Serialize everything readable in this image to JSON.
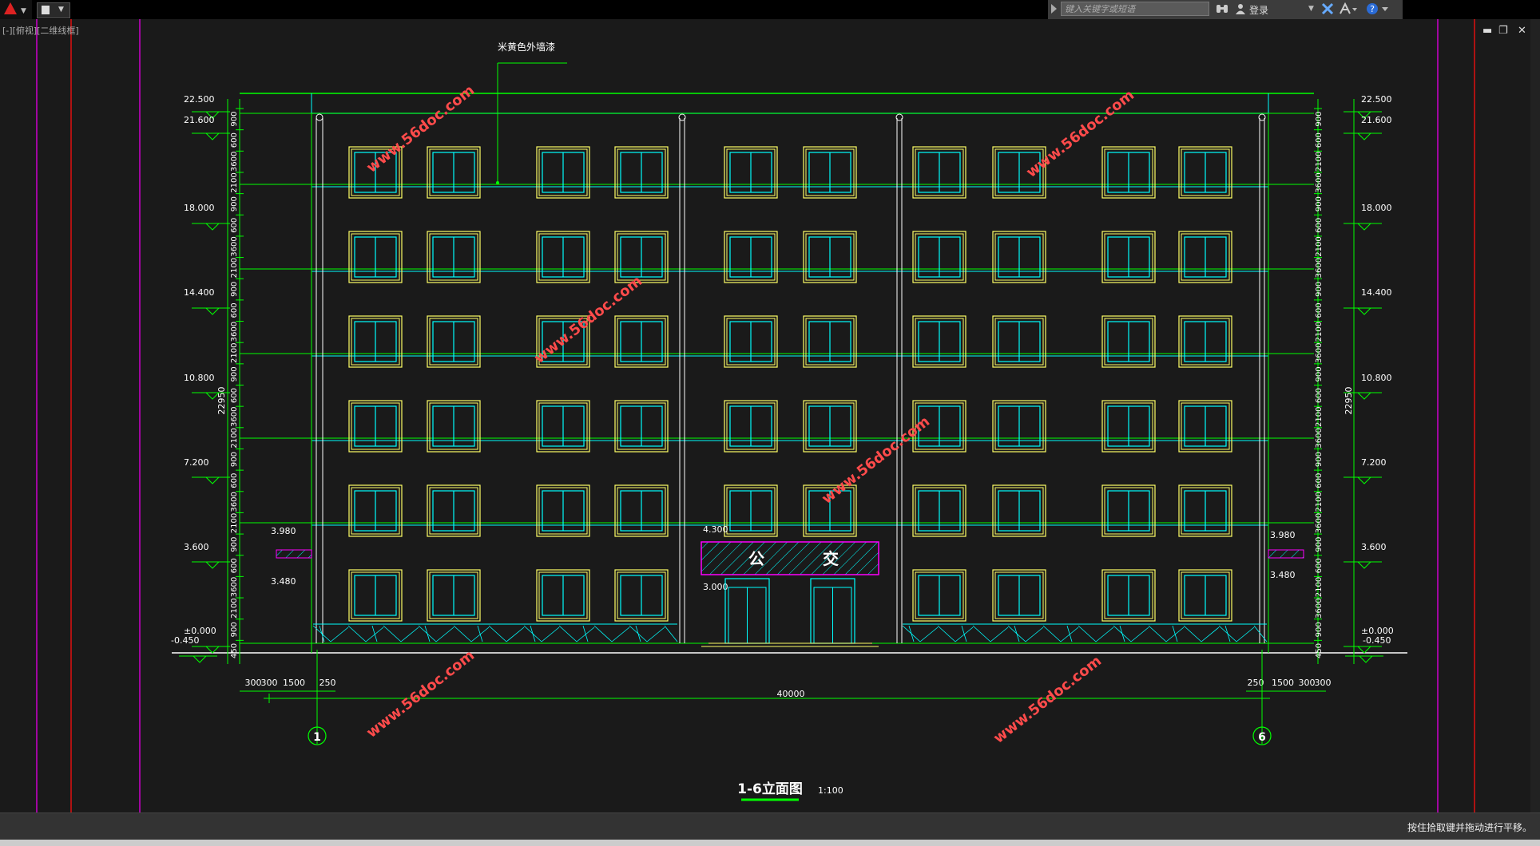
{
  "app": {
    "search_placeholder": "键入关键字或短语",
    "login_label": "登录",
    "viewport_label": "[-][俯视][二维线框]",
    "status_text": "按住拾取键并拖动进行平移。"
  },
  "drawing": {
    "paint_note": "米黄色外墙漆",
    "sign_left": "公",
    "sign_right": "交",
    "title": "1-6立面图",
    "scale": "1:100",
    "axis_left": "1",
    "axis_right": "6",
    "total_width": "40000",
    "total_height": "22950",
    "left_bottom_dims": [
      "300",
      "300",
      "1500",
      "250"
    ],
    "right_bottom_dims": [
      "250",
      "1500",
      "300",
      "300"
    ],
    "canopy_labels": [
      "3.980",
      "3.480"
    ],
    "entrance_labels": [
      "4.300",
      "3.000"
    ],
    "elevations": [
      "22.500",
      "21.600",
      "18.000",
      "14.400",
      "10.800",
      "7.200",
      "3.600",
      "±0.000",
      "-0.450"
    ],
    "floor_dims_left": [
      "900",
      "600",
      "3600",
      "2100",
      "900",
      "600",
      "3600",
      "2100",
      "900",
      "600",
      "3600",
      "2100",
      "900",
      "600",
      "3600",
      "2100",
      "900",
      "600",
      "3600",
      "2100",
      "900",
      "600",
      "3600",
      "2100",
      "900",
      "450"
    ],
    "floor_dims_right": [
      "900",
      "600",
      "2100",
      "3600",
      "900",
      "600",
      "2100",
      "3600",
      "900",
      "600",
      "2100",
      "3600",
      "900",
      "600",
      "2100",
      "3600",
      "900",
      "600",
      "2100",
      "3600",
      "900",
      "600",
      "2100",
      "3600",
      "900",
      "450"
    ],
    "watermarks": [
      "www.56doc.com",
      "www.56doc.com",
      "www.56doc.com",
      "www.56doc.com",
      "www.56doc.com",
      "www.56doc.com",
      "www.56doc.com"
    ]
  },
  "colors": {
    "green": "#00ff00",
    "cyan": "#00ffff",
    "yellow": "#ffff66",
    "magenta": "#ff00ff",
    "white": "#ffffff",
    "watermark": "#ff4b4b",
    "background": "#1a1a1a"
  }
}
